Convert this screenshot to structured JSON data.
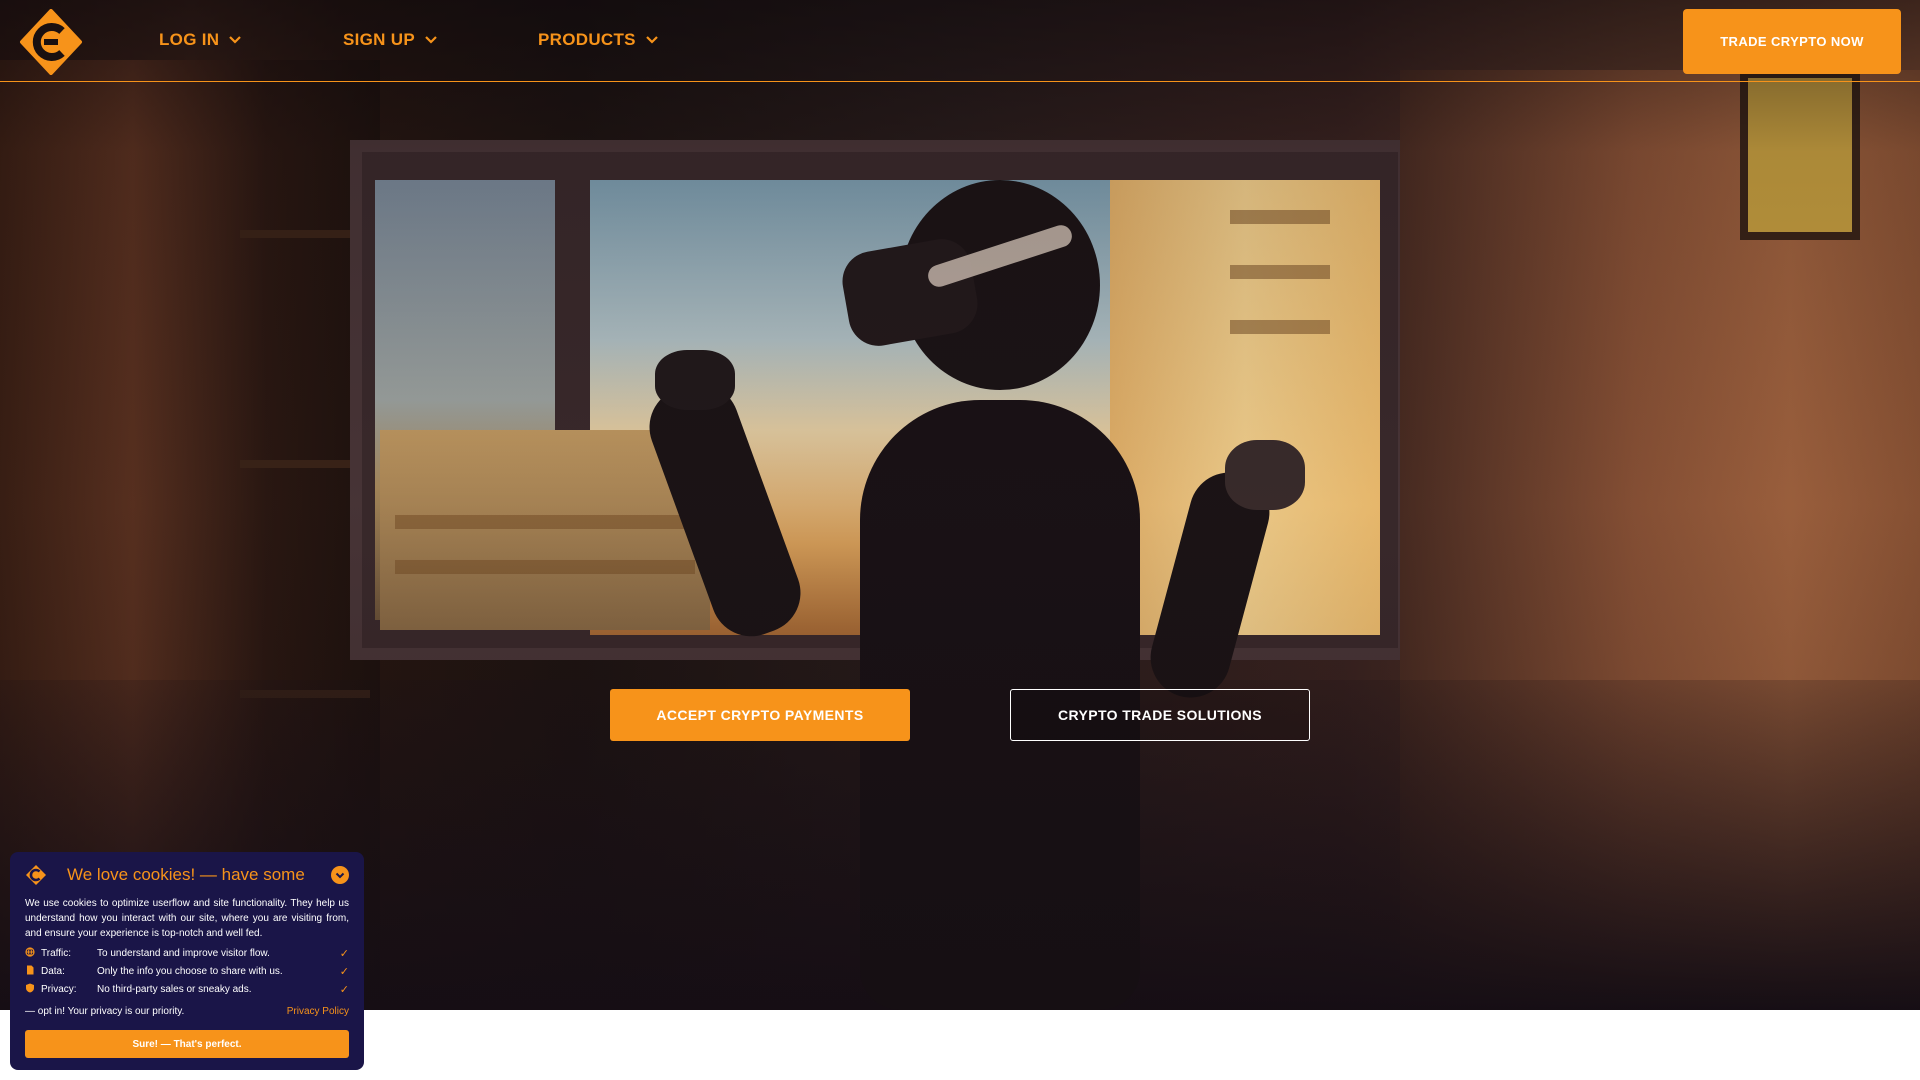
{
  "brand": {
    "accent": "#f7931a",
    "panel_bg": "#1a1548",
    "logo_icon": "c-hexagon-logo-icon"
  },
  "nav": {
    "items": [
      {
        "label": "LOG IN",
        "icon": "chevron-down-icon"
      },
      {
        "label": "SIGN UP",
        "icon": "chevron-down-icon"
      },
      {
        "label": "PRODUCTS",
        "icon": "chevron-down-icon"
      }
    ],
    "cta_label": "TRADE CRYPTO NOW"
  },
  "hero": {
    "primary_button": "ACCEPT CRYPTO PAYMENTS",
    "secondary_button": "CRYPTO TRADE SOLUTIONS"
  },
  "cookie": {
    "title": "We love cookies! — have some",
    "description": "We use cookies to optimize userflow and site functionality. They help us understand how you interact with our site, where you are visiting from, and ensure your experience is top-notch and well fed.",
    "rows": [
      {
        "icon": "globe-icon",
        "key": "Traffic:",
        "value": "To understand and improve visitor flow."
      },
      {
        "icon": "file-icon",
        "key": "Data:",
        "value": "Only the info you choose to share with us."
      },
      {
        "icon": "shield-icon",
        "key": "Privacy:",
        "value": "No third-party sales or sneaky ads."
      }
    ],
    "footer_text": "— opt in! Your privacy is our priority.",
    "privacy_link": "Privacy Policy",
    "accept_label": "Sure! — That's perfect."
  }
}
